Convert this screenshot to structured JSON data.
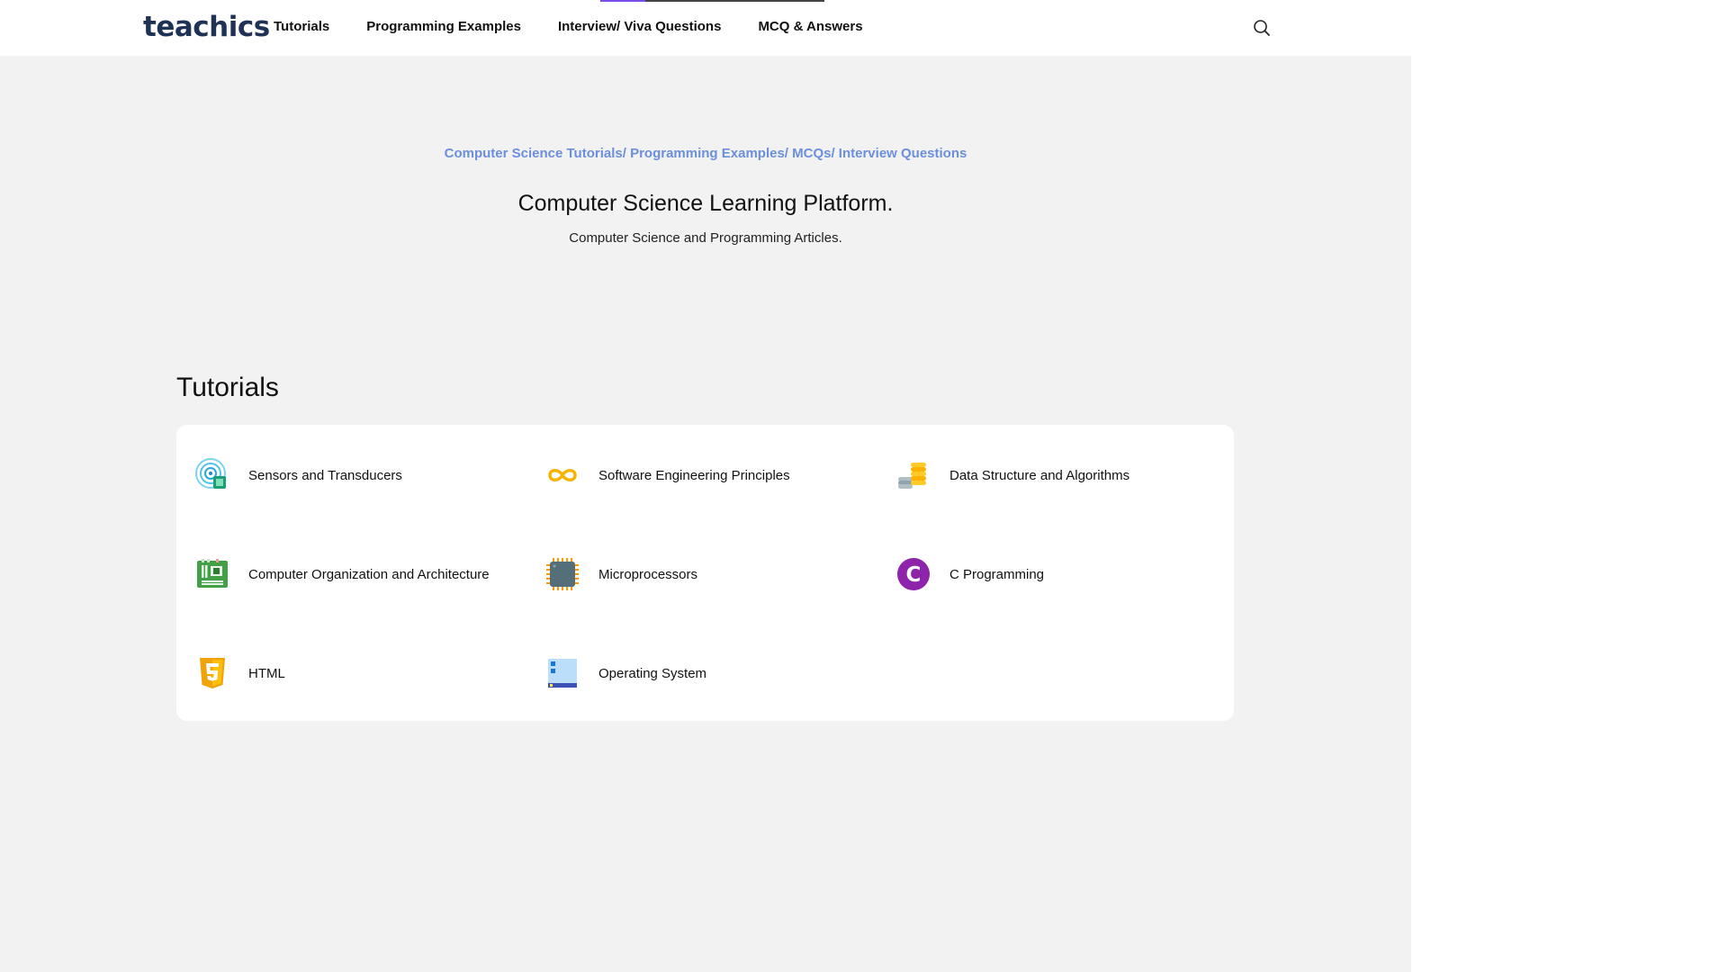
{
  "header": {
    "logo": "teachics",
    "nav": [
      "Tutorials",
      "Programming Examples",
      "Interview/ Viva Questions",
      "MCQ & Answers"
    ],
    "search_icon": "search-icon",
    "scroll_progress": 0.2
  },
  "hero": {
    "tagline": "Computer Science Tutorials/ Programming Examples/ MCQs/ Interview Questions",
    "title": "Computer Science Learning Platform.",
    "subtitle": "Computer Science and Programming Articles."
  },
  "tutorials": {
    "heading": "Tutorials",
    "items": [
      {
        "label": "Sensors and Transducers",
        "icon": "sensor-icon"
      },
      {
        "label": "Software Engineering Principles",
        "icon": "infinity-icon"
      },
      {
        "label": "Data Structure and Algorithms",
        "icon": "coins-stack-icon"
      },
      {
        "label": "Computer Organization and Architecture",
        "icon": "motherboard-icon"
      },
      {
        "label": "Microprocessors",
        "icon": "chip-icon"
      },
      {
        "label": "C Programming",
        "icon": "c-language-icon"
      },
      {
        "label": "HTML",
        "icon": "html5-icon"
      },
      {
        "label": "Operating System",
        "icon": "window-icon"
      }
    ]
  },
  "colors": {
    "accent_link": "#6b8fdc",
    "logo": "#1f3255",
    "progress": "#7a4de8",
    "background": "#f2f2f2"
  }
}
